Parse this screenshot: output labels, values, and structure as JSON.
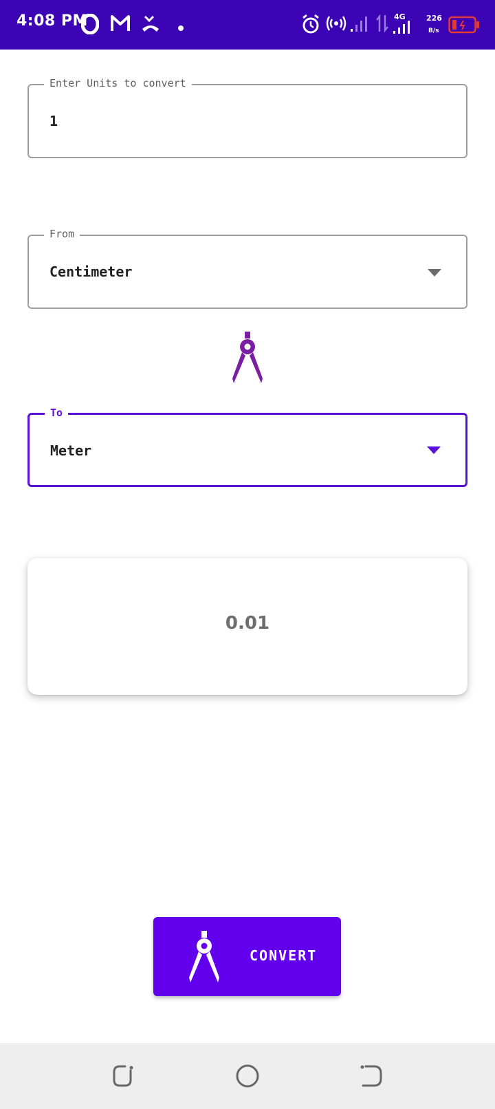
{
  "status_bar": {
    "time": "4:08 PM",
    "network_type": "4G",
    "speed_value": "226",
    "speed_unit": "B/s",
    "icons": [
      "opera-icon",
      "gmail-icon",
      "missed-call-icon",
      "dot-icon",
      "alarm-icon",
      "hotspot-icon",
      "signal-icon",
      "data-arrows-icon",
      "signal-4g-icon",
      "battery-low-icon"
    ],
    "background_color": "#3b03b4"
  },
  "input_field": {
    "label": "Enter Units to convert",
    "value": "1"
  },
  "from_field": {
    "label": "From",
    "selected": "Centimeter"
  },
  "divider_icon": "compass-icon",
  "to_field": {
    "label": "To",
    "selected": "Meter"
  },
  "result": {
    "value": "0.01"
  },
  "convert_button": {
    "label": "CONVERT",
    "icon": "compass-icon",
    "color": "#6200ee"
  },
  "nav_bar": {
    "buttons": [
      "recents-icon",
      "home-icon",
      "back-icon"
    ]
  },
  "colors": {
    "accent": "#5a10d8",
    "icon_purple": "#7b1fa2"
  }
}
